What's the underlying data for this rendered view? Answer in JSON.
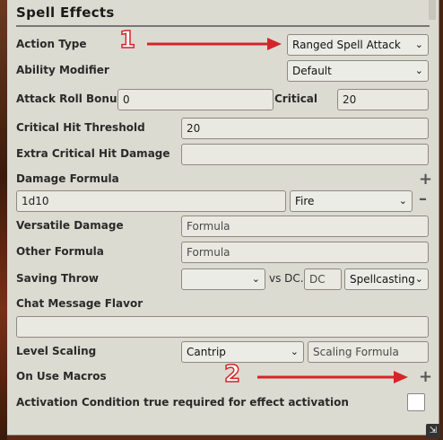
{
  "section": {
    "title": "Spell Effects"
  },
  "fields": {
    "action_type": {
      "label": "Action Type",
      "value": "Ranged Spell Attack"
    },
    "ability_modifier": {
      "label": "Ability Modifier",
      "value": "Default"
    },
    "attack_roll_bonus": {
      "label": "Attack Roll Bonus",
      "value": "0"
    },
    "critical": {
      "label": "Critical",
      "value": "20"
    },
    "crit_threshold": {
      "label": "Critical Hit Threshold",
      "value": "20"
    },
    "extra_crit": {
      "label": "Extra Critical Hit Damage",
      "value": ""
    },
    "damage_formula": {
      "label": "Damage Formula",
      "formula": "1d10",
      "type": "Fire"
    },
    "versatile": {
      "label": "Versatile Damage",
      "placeholder": "Formula"
    },
    "other": {
      "label": "Other Formula",
      "placeholder": "Formula"
    },
    "saving_throw": {
      "label": "Saving Throw",
      "value": "",
      "vs_label": "vs DC.",
      "dc_placeholder": "DC",
      "dc_mode": "Spellcasting"
    },
    "chat_flavor": {
      "label": "Chat Message Flavor",
      "value": ""
    },
    "level_scaling": {
      "label": "Level Scaling",
      "value": "Cantrip",
      "placeholder": "Scaling Formula"
    },
    "on_use_macros": {
      "label": "On Use Macros"
    },
    "activation": {
      "label": "Activation Condition true required for effect activation",
      "checked": false
    }
  },
  "annotations": [
    {
      "number": "1",
      "color": "#d4252b"
    },
    {
      "number": "2",
      "color": "#d4252b"
    }
  ],
  "icons": {
    "add": "plus-icon",
    "remove": "minus-icon",
    "dropdown": "chevron-down-icon",
    "resize": "resize-icon"
  }
}
